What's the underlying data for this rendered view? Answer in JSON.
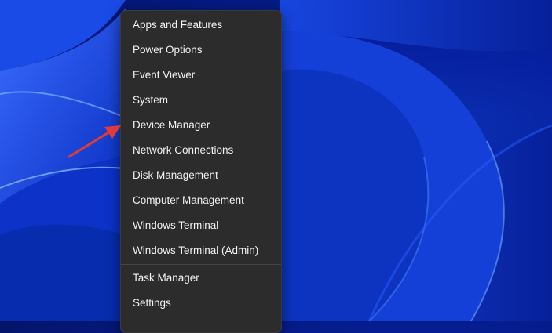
{
  "menu": {
    "items": [
      "Apps and Features",
      "Power Options",
      "Event Viewer",
      "System",
      "Device Manager",
      "Network Connections",
      "Disk Management",
      "Computer Management",
      "Windows Terminal",
      "Windows Terminal (Admin)"
    ],
    "items2": [
      "Task Manager",
      "Settings"
    ]
  },
  "annotation": {
    "arrow_color": "#e03a3a",
    "target": "Device Manager"
  }
}
